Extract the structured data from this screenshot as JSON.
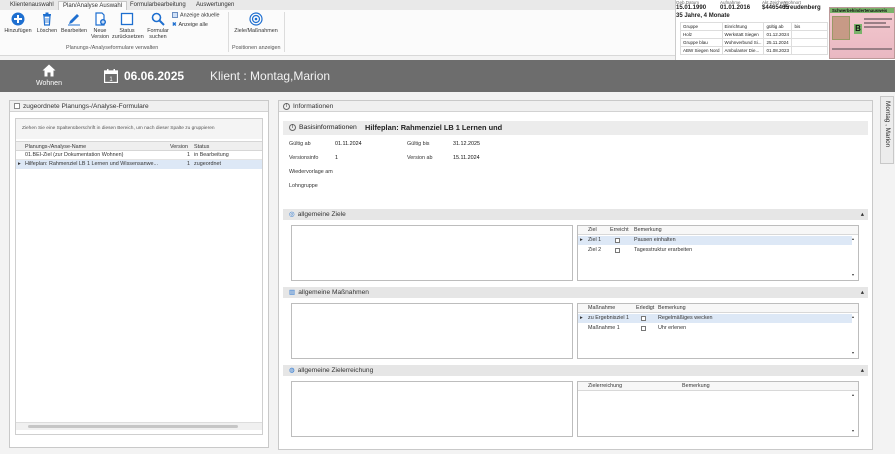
{
  "ribbon": {
    "tabs": [
      "Klientenauswahl",
      "Plan/Analyse Auswahl",
      "Formularbearbeitung",
      "Auswertungen"
    ],
    "active_tab": 1,
    "buttons": {
      "hinzufuegen": "Hinzufügen",
      "loeschen": "Löschen",
      "bearbeiten": "Bearbeiten",
      "neue_version": "Neue Version",
      "status_zurueck": "Status zurücksetzen",
      "formular_suchen": "Formular suchen",
      "ziele": "Ziele/Maßnahmen"
    },
    "checks": {
      "anzeige_aktuelle": "Anzeige aktuelle",
      "anzeige_alle": "Anzeige alle"
    },
    "groups": {
      "verwalten": "Planungs-/Analyseformulare verwalten",
      "positionen": "Positionen anzeigen"
    }
  },
  "patient": {
    "geb_label": "Geb.Datum",
    "geb": "15.01.1990",
    "aufnahme_label": "Aufnahme",
    "aufnahme": "01.01.2016",
    "akt_label": "Akt.Zeichen",
    "akt": "$4465465",
    "wohnort_label": "Wohnort",
    "wohnort": "Freudenberg",
    "age": "35 Jahre, 4 Monate",
    "table_headers": [
      "Gruppe",
      "Einrichtung",
      "gültig ab",
      "bis"
    ],
    "table_rows": [
      [
        "Holz",
        "Werkstatt Siegen",
        "01.12.2024",
        ""
      ],
      [
        "Gruppe blau",
        "Wohnverbund Si...",
        "25.11.2024",
        ""
      ],
      [
        "ABW Siegen Nord",
        "Ambulanter Die...",
        "01.08.2023",
        ""
      ]
    ],
    "sb_title": "Schwerbehindertenausweis",
    "sb_letter": "B"
  },
  "header": {
    "home_label": "Wohnen",
    "date": "06.06.2025",
    "client": "Klient : Montag,Marion"
  },
  "side_tab": "Montag , Marion",
  "left_panel": {
    "title": "zugeordnete Planungs-/Analyse-Formulare",
    "group_hint": "Ziehen Sie eine Spaltenüberschrift in diesen Bereich, um nach dieser Spalte zu gruppieren",
    "columns": [
      "Planungs-/Analyse-Name",
      "Version",
      "Status"
    ],
    "rows": [
      {
        "name": "01.BEI-Ziel (zur Dokumentation Wohnen)",
        "version": "1",
        "status": "in Bearbeitung"
      },
      {
        "name": "Hilfeplan: Rahmenziel LB 1 Lernen und Wissensanwe...",
        "version": "1",
        "status": "zugeordnet"
      }
    ]
  },
  "info_panel": {
    "title": "Informationen",
    "basis_label": "Basisinformationen",
    "basis_title": "Hilfeplan: Rahmenziel LB 1 Lernen und",
    "gueltig_ab_label": "Gültig ab",
    "gueltig_ab": "01.11.2024",
    "gueltig_bis_label": "Gültig bis",
    "gueltig_bis": "31.12.2025",
    "versionsinfo_label": "Versionsinfo",
    "versionsinfo": "1",
    "version_ab_label": "Version ab",
    "version_ab": "15.11.2024",
    "wiedervorlage_label": "Wiedervorlage am",
    "lohngruppe_label": "Lohngruppe"
  },
  "ziele": {
    "title": "allgemeine Ziele",
    "columns": [
      "Ziel",
      "Erreicht",
      "Bemerkung"
    ],
    "rows": [
      {
        "name": "Ziel 1",
        "bemerkung": "Pausen einhalten"
      },
      {
        "name": "Ziel 2",
        "bemerkung": "Tagesstruktur erarbeiten"
      }
    ]
  },
  "massnahmen": {
    "title": "allgemeine Maßnahmen",
    "columns": [
      "Maßnahme",
      "Erledigt",
      "Bemerkung"
    ],
    "rows": [
      {
        "name": "zu Ergebnisziel 1",
        "bemerkung": "Regelmäßiges wecken"
      },
      {
        "name": "Maßnahme 1",
        "bemerkung": "Uhr erlenen"
      }
    ]
  },
  "zielerreichung": {
    "title": "allgemeine Zielerreichung",
    "columns": [
      "Zielerreichung",
      "Bemerkung"
    ]
  },
  "colors": {
    "accent": "#1e6fd0",
    "header_bg": "#6d6d6d",
    "selection": "#dde8f6"
  }
}
